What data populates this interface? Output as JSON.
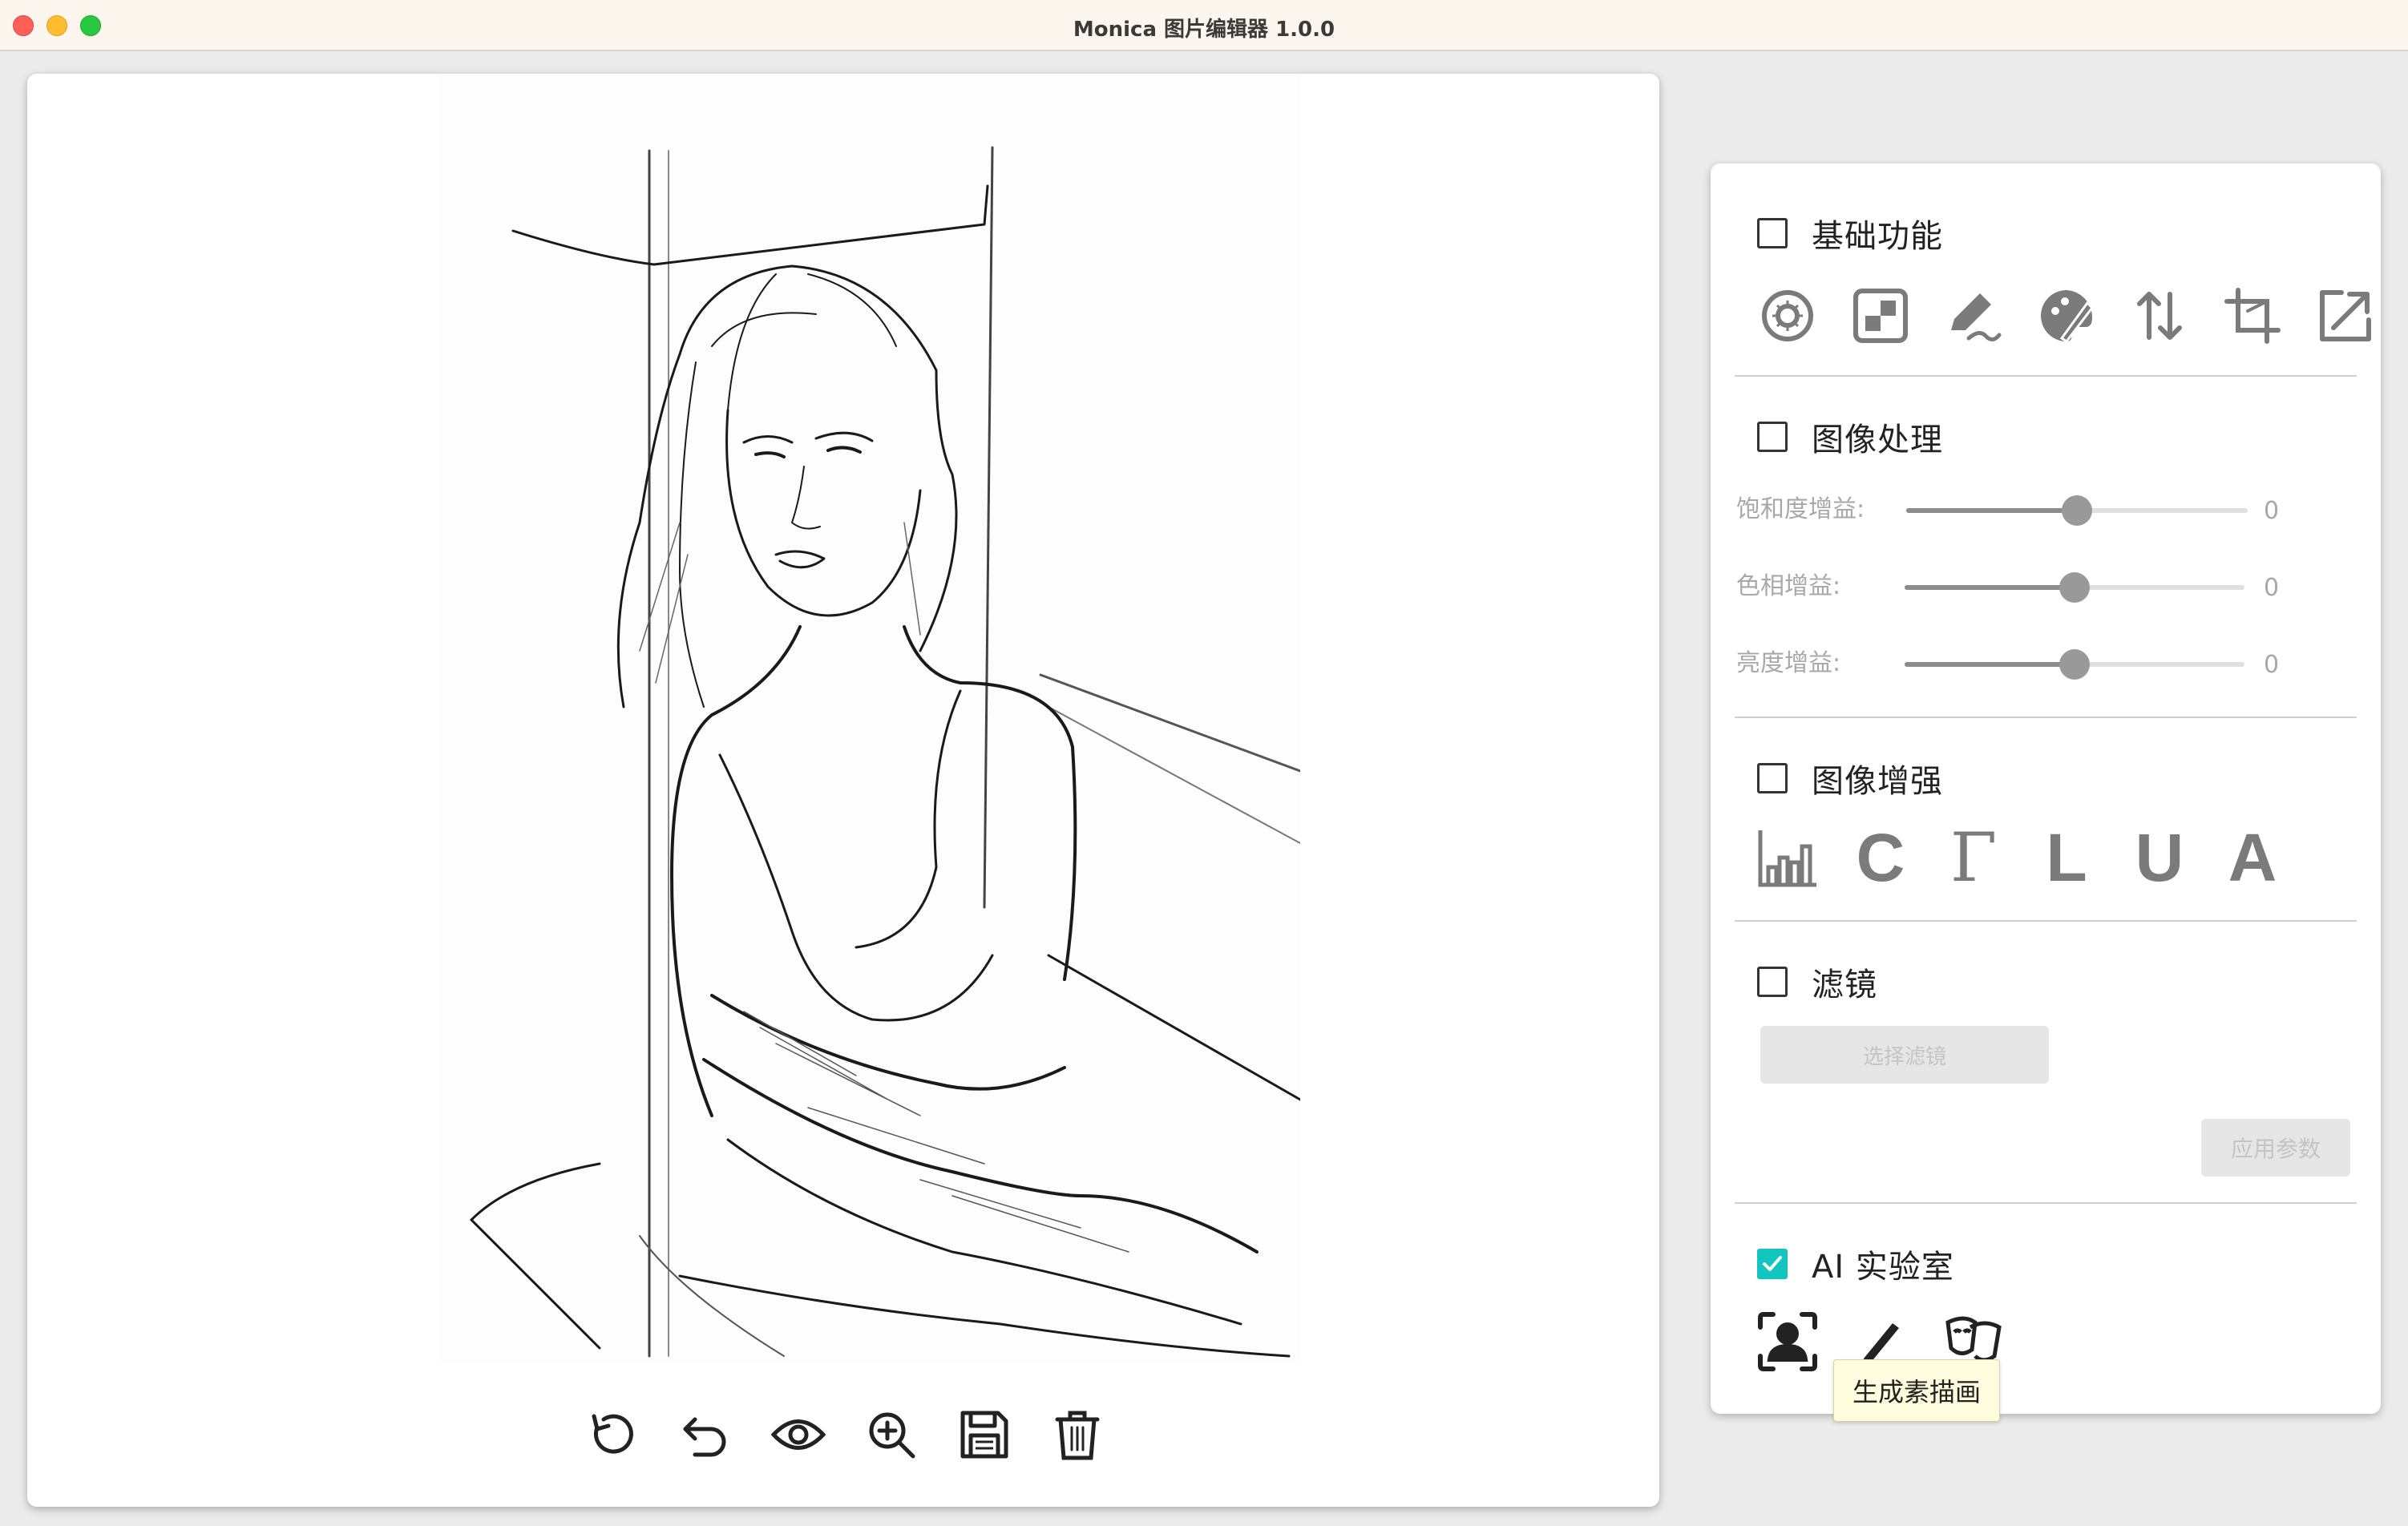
{
  "window": {
    "title": "Monica 图片编辑器 1.0.0"
  },
  "canvas": {
    "image_description_icon": "pencil-sketch-image",
    "toolbar": [
      {
        "name": "rotate-icon"
      },
      {
        "name": "undo-icon"
      },
      {
        "name": "preview-eye-icon"
      },
      {
        "name": "zoom-in-icon"
      },
      {
        "name": "save-icon"
      },
      {
        "name": "delete-icon"
      }
    ]
  },
  "panel": {
    "basic": {
      "label": "基础功能",
      "checked": false,
      "icons": [
        "color-picker-icon",
        "mosaic-icon",
        "draw-pen-icon",
        "palette-brush-icon",
        "flip-icon",
        "crop-icon",
        "resize-icon"
      ]
    },
    "processing": {
      "label": "图像处理",
      "checked": false,
      "sliders": [
        {
          "label": "饱和度增益:",
          "value": "0",
          "level": 0.5
        },
        {
          "label": "色相增益:",
          "value": "0",
          "level": 0.5
        },
        {
          "label": "亮度增益:",
          "value": "0",
          "level": 0.5
        }
      ]
    },
    "enhance": {
      "label": "图像增强",
      "checked": false,
      "items": [
        {
          "icon": "histogram-icon",
          "text": ""
        },
        {
          "icon": "clahe-icon",
          "text": "C"
        },
        {
          "icon": "gamma-icon",
          "text": "Γ"
        },
        {
          "icon": "laplace-icon",
          "text": "L"
        },
        {
          "icon": "usm-icon",
          "text": "U"
        },
        {
          "icon": "ace-icon",
          "text": "A"
        }
      ]
    },
    "filter": {
      "label": "滤镜",
      "checked": false,
      "select_label": "选择滤镜",
      "apply_label": "应用参数"
    },
    "ai_lab": {
      "label": "AI 实验室",
      "checked": true,
      "icons": [
        "face-detect-icon",
        "sketch-pencil-icon",
        "cartoon-mask-icon"
      ]
    }
  },
  "tooltip": {
    "text": "生成素描画"
  },
  "colors": {
    "accent": "#13c5bf",
    "title_bar": "#fcf6ee"
  }
}
